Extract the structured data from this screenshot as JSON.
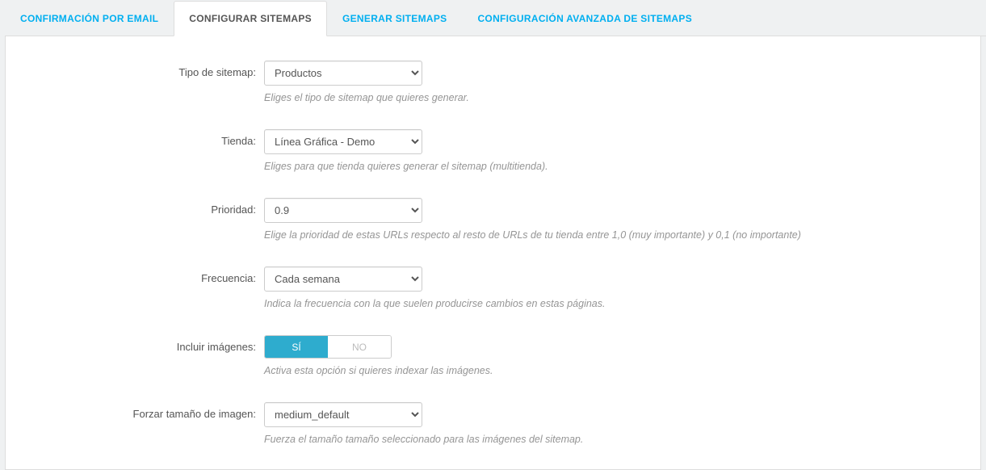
{
  "tabs": {
    "email": "CONFIRMACIÓN POR EMAIL",
    "configure": "CONFIGURAR SITEMAPS",
    "generate": "GENERAR SITEMAPS",
    "advanced": "CONFIGURACIÓN AVANZADA DE SITEMAPS"
  },
  "form": {
    "type": {
      "label": "Tipo de sitemap:",
      "value": "Productos",
      "help": "Eliges el tipo de sitemap que quieres generar."
    },
    "shop": {
      "label": "Tienda:",
      "value": "Línea Gráfica - Demo",
      "help": "Eliges para que tienda quieres generar el sitemap (multitienda)."
    },
    "priority": {
      "label": "Prioridad:",
      "value": "0.9",
      "help": "Elige la prioridad de estas URLs respecto al resto de URLs de tu tienda entre 1,0 (muy importante) y 0,1 (no importante)"
    },
    "frequency": {
      "label": "Frecuencia:",
      "value": "Cada semana",
      "help": "Indica la frecuencia con la que suelen producirse cambios en estas páginas."
    },
    "images": {
      "label": "Incluir imágenes:",
      "yes": "SÍ",
      "no": "NO",
      "help": "Activa esta opción si quieres indexar las imágenes."
    },
    "imgsize": {
      "label": "Forzar tamaño de imagen:",
      "value": "medium_default",
      "help": "Fuerza el tamaño tamaño seleccionado para las imágenes del sitemap."
    }
  }
}
